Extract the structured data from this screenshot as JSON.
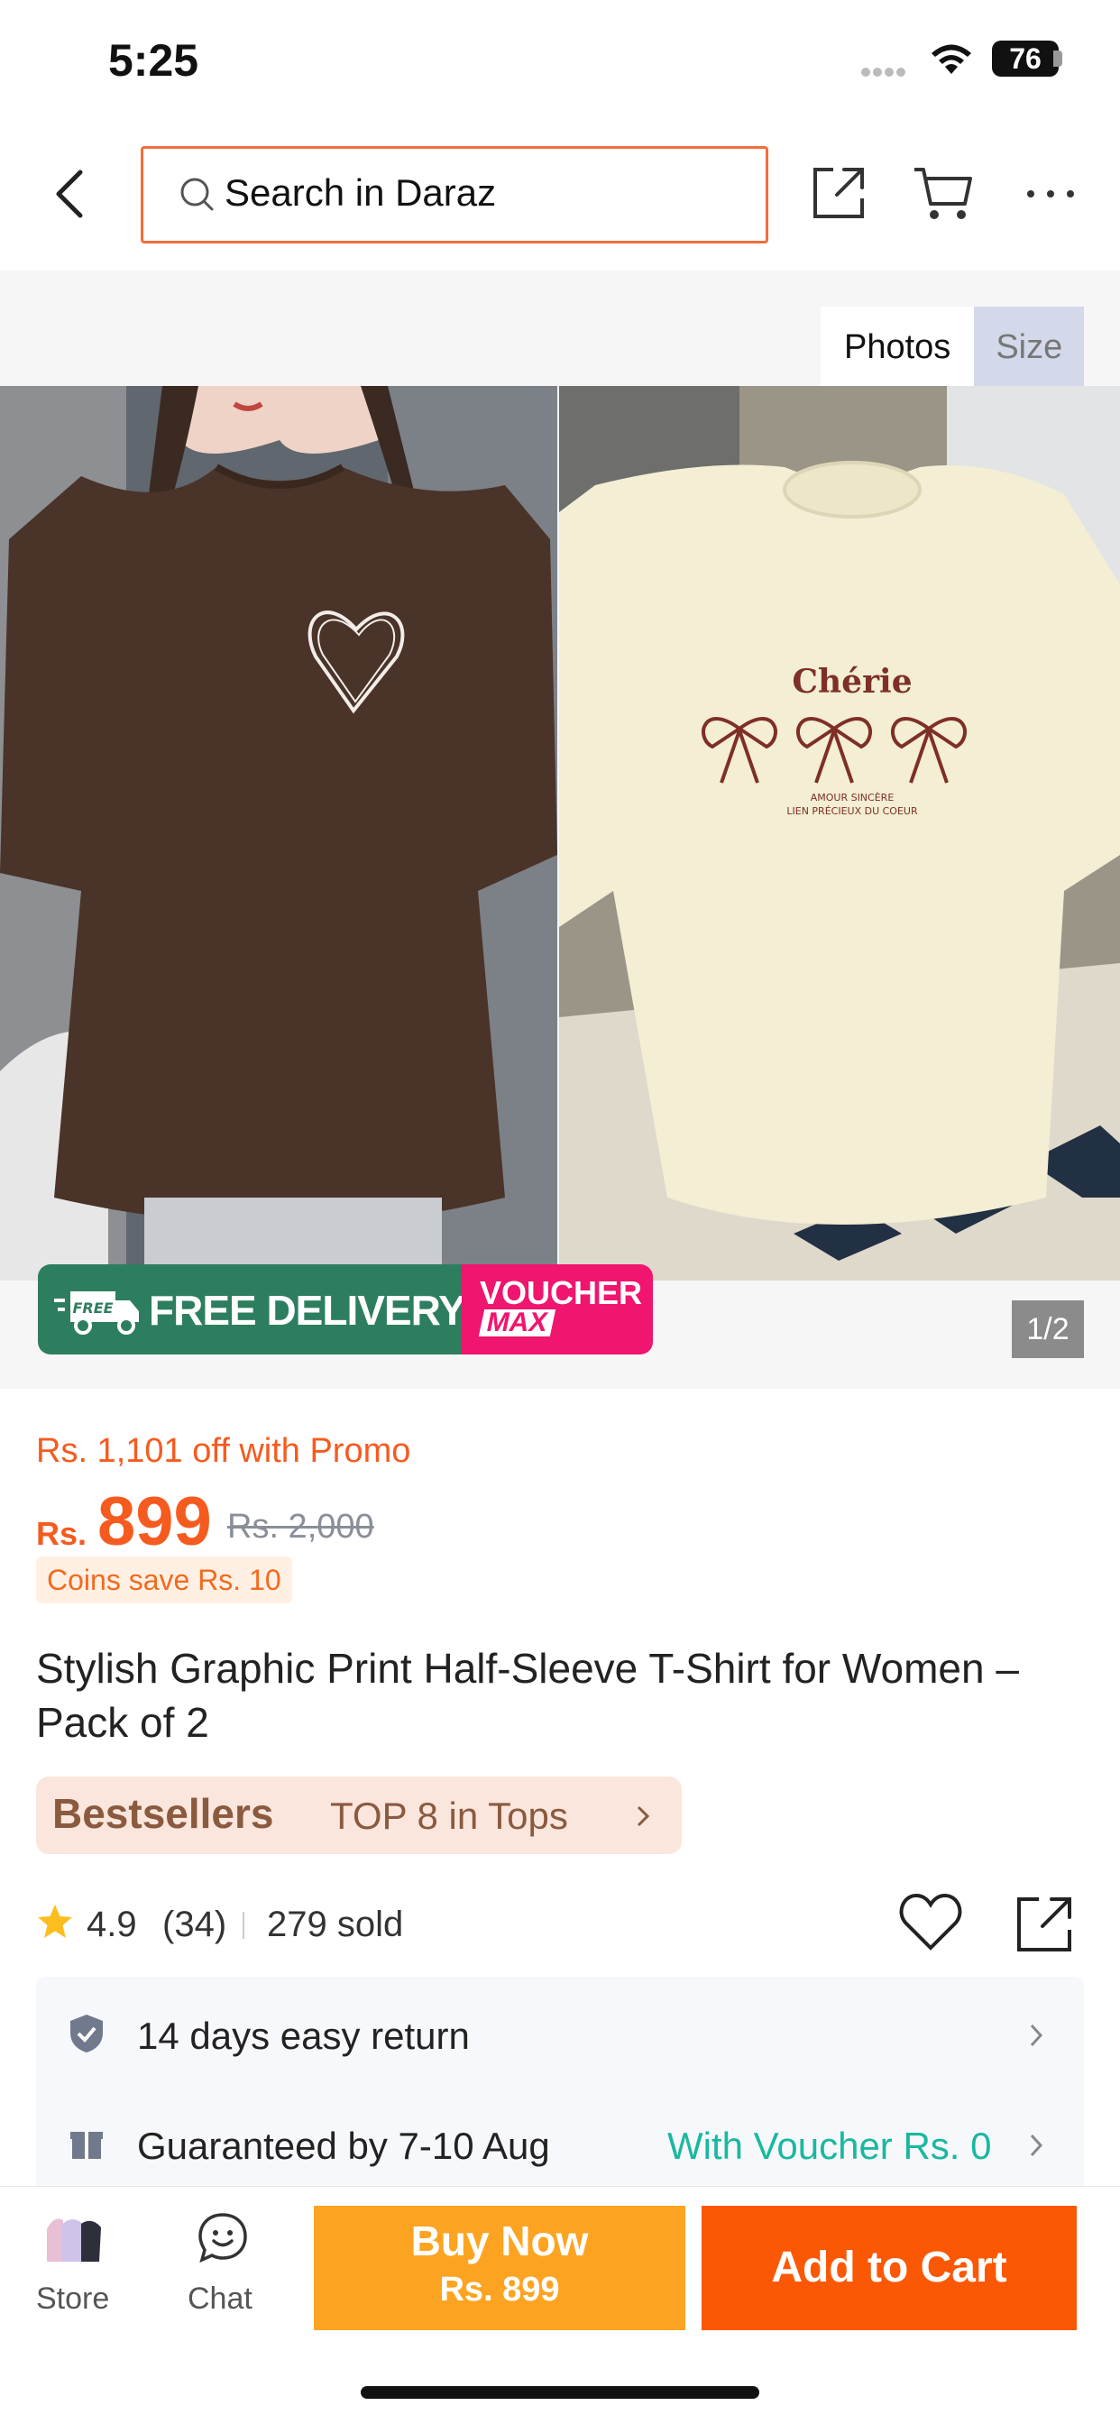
{
  "status_bar": {
    "time": "5:25",
    "battery": "76"
  },
  "header": {
    "search_placeholder": "Search in Daraz",
    "icons": [
      "back-icon",
      "search-icon",
      "share-icon",
      "cart-icon",
      "more-icon"
    ]
  },
  "gallery": {
    "tabs": [
      "Photos",
      "Size"
    ],
    "active_tab": "Photos",
    "counter": "1/2",
    "badge_free": "FREE DELIVERY",
    "badge_truck_text": "FREE",
    "badge_voucher_line1": "VOUCHER",
    "badge_voucher_line2": "MAX",
    "right_shirt_print": {
      "title": "Chérie",
      "line1": "AMOUR SINCÈRE",
      "line2": "LIEN PRÉCIEUX DU COEUR"
    }
  },
  "price": {
    "promo": "Rs. 1,101 off with Promo",
    "currency": "Rs.",
    "current": "899",
    "original": "Rs. 2,000",
    "coins": "Coins save Rs. 10"
  },
  "product": {
    "title": "Stylish Graphic Print Half-Sleeve T-Shirt for Women – Pack of 2"
  },
  "best_sellers": {
    "label": "Bestsellers",
    "rank": "TOP 8 in Tops"
  },
  "rating": {
    "score": "4.9",
    "count": "(34)",
    "sold": "279 sold"
  },
  "services": {
    "return": "14 days easy return",
    "delivery": "Guaranteed by 7-10 Aug",
    "voucher": "With Voucher Rs. 0"
  },
  "bottom_bar": {
    "store_label": "Store",
    "chat_label": "Chat",
    "buy_now": "Buy Now",
    "buy_now_price": "Rs. 899",
    "add_to_cart": "Add to Cart"
  },
  "colors": {
    "accent": "#f55b1f",
    "buy_now": "#fca421",
    "add_to_cart": "#fb5806",
    "free_delivery": "#2d7e5f",
    "voucher": "#f0156e",
    "voucher_text": "#19b8a0"
  }
}
